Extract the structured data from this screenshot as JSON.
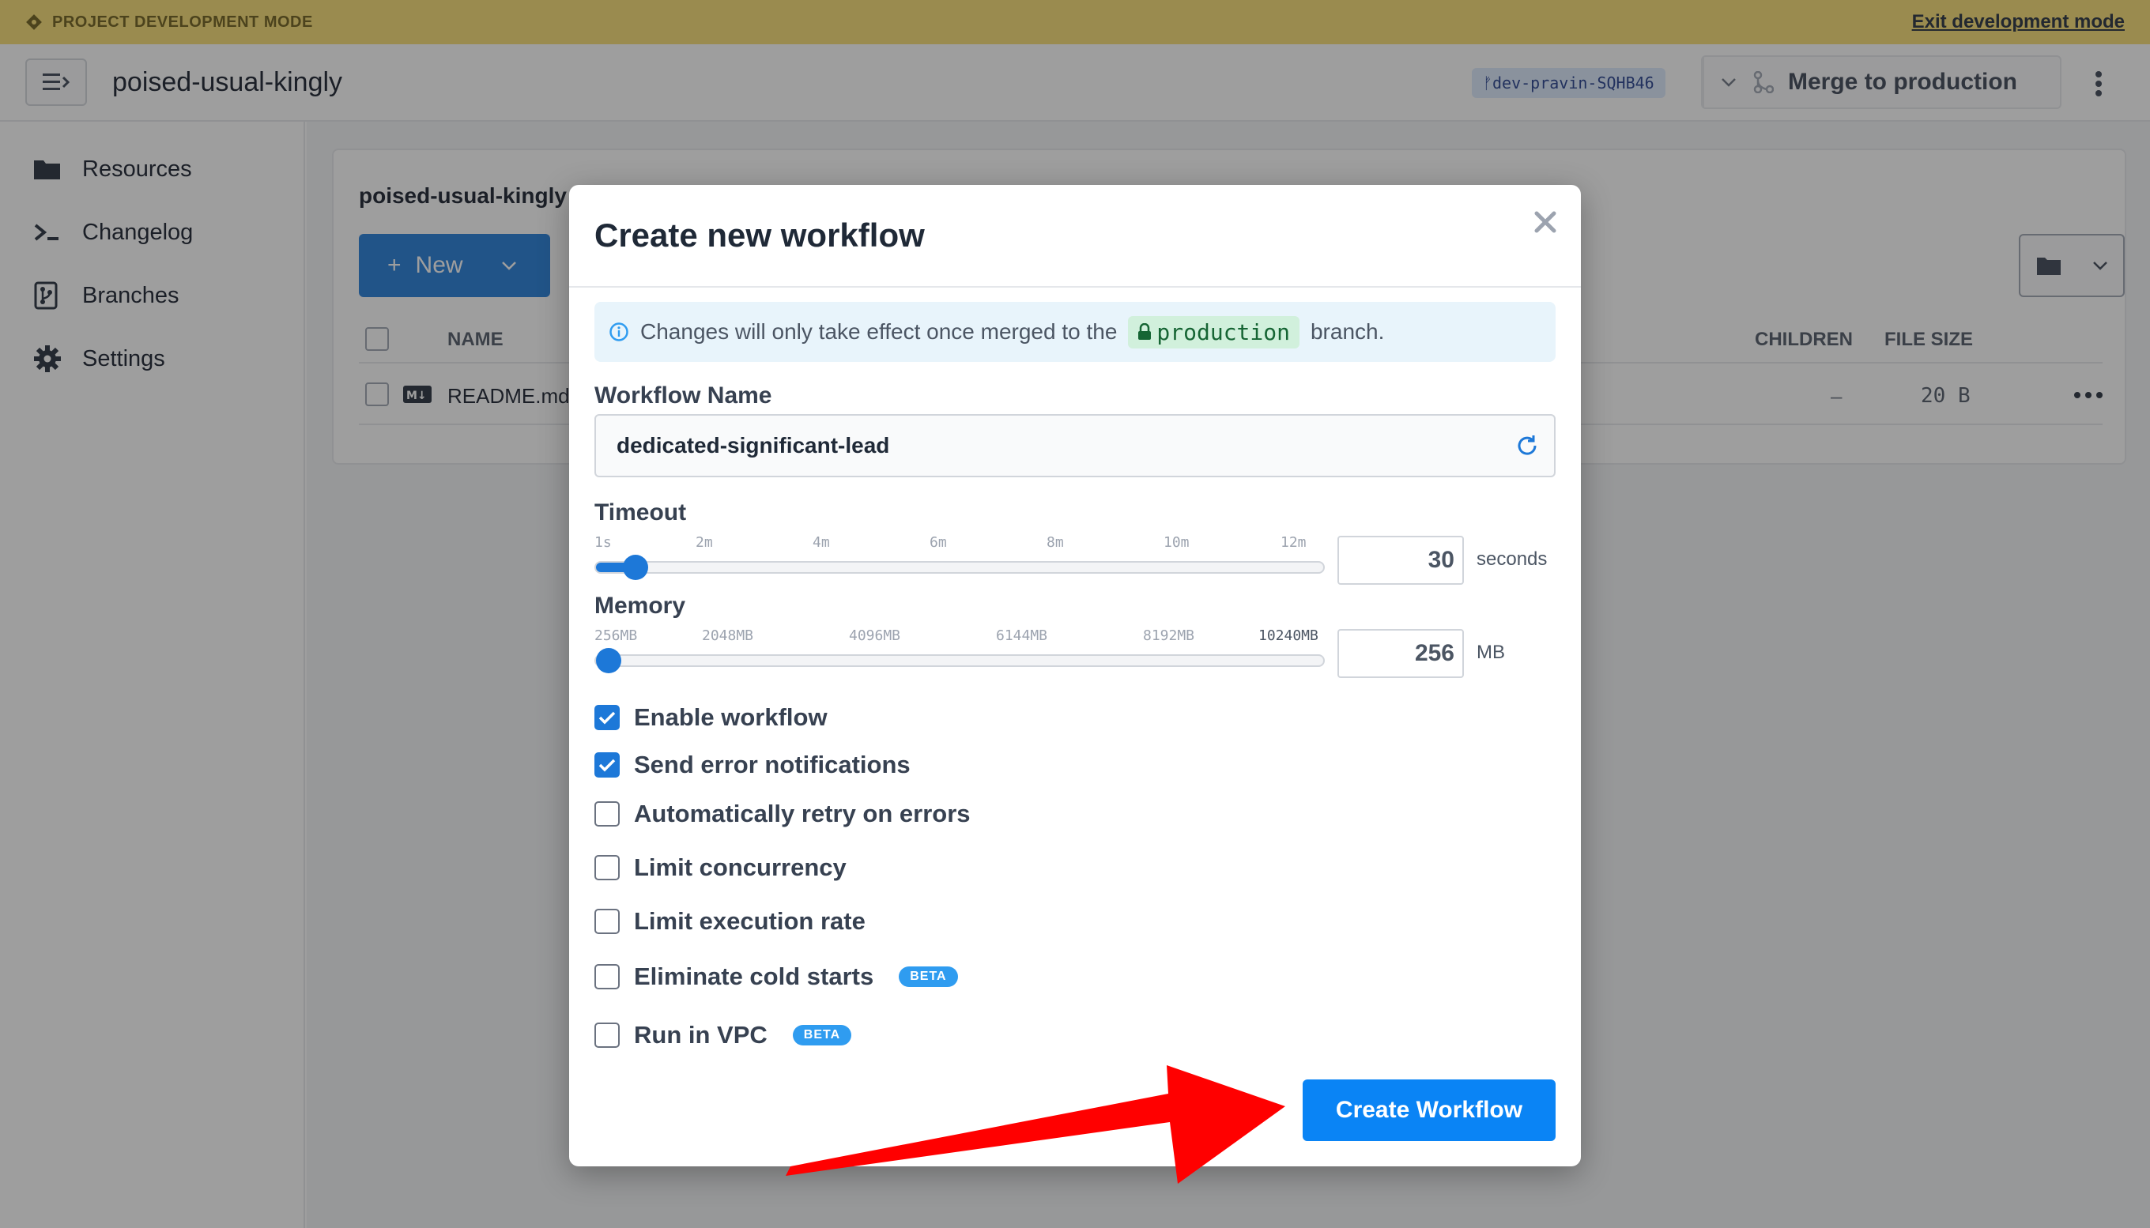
{
  "banner": {
    "mode_label": "PROJECT DEVELOPMENT MODE",
    "exit_label": "Exit development mode"
  },
  "header": {
    "project_name": "poised-usual-kingly",
    "branch": "dev-pravin-SQHB46",
    "merge_label": "Merge to production"
  },
  "sidebar": {
    "items": [
      {
        "label": "Resources",
        "icon": "folder-icon"
      },
      {
        "label": "Changelog",
        "icon": "terminal-icon"
      },
      {
        "label": "Branches",
        "icon": "branches-icon"
      },
      {
        "label": "Settings",
        "icon": "gear-icon"
      }
    ]
  },
  "resources": {
    "breadcrumb": "poised-usual-kingly /",
    "new_label": "New",
    "columns": {
      "name": "NAME",
      "children": "CHILDREN",
      "file_size": "FILE SIZE"
    },
    "rows": [
      {
        "name": "README.md",
        "children": "–",
        "file_size": "20 B"
      }
    ]
  },
  "modal": {
    "title": "Create new workflow",
    "info_prefix": "Changes will only take effect once merged to the",
    "info_branch": "production",
    "info_suffix": "branch.",
    "name_label": "Workflow Name",
    "name_value": "dedicated-significant-lead",
    "timeout": {
      "label": "Timeout",
      "ticks": [
        "1s",
        "2m",
        "4m",
        "6m",
        "8m",
        "10m",
        "12m"
      ],
      "value": "30",
      "unit": "seconds",
      "level": 0.054
    },
    "memory": {
      "label": "Memory",
      "ticks": [
        "256MB",
        "2048MB",
        "4096MB",
        "6144MB",
        "8192MB",
        "10240MB"
      ],
      "value": "256",
      "unit": "MB",
      "level": 0
    },
    "options": [
      {
        "label": "Enable workflow",
        "checked": true
      },
      {
        "label": "Send error notifications",
        "checked": true
      },
      {
        "label": "Automatically retry on errors",
        "checked": false
      },
      {
        "label": "Limit concurrency",
        "checked": false
      },
      {
        "label": "Limit execution rate",
        "checked": false
      },
      {
        "label": "Eliminate cold starts",
        "checked": false,
        "badge": "BETA"
      },
      {
        "label": "Run in VPC",
        "checked": false,
        "badge": "BETA"
      }
    ],
    "submit_label": "Create Workflow"
  },
  "colors": {
    "accent": "#0a84f5",
    "banner": "#f7dc6f",
    "annotation_arrow": "#ff0000"
  }
}
